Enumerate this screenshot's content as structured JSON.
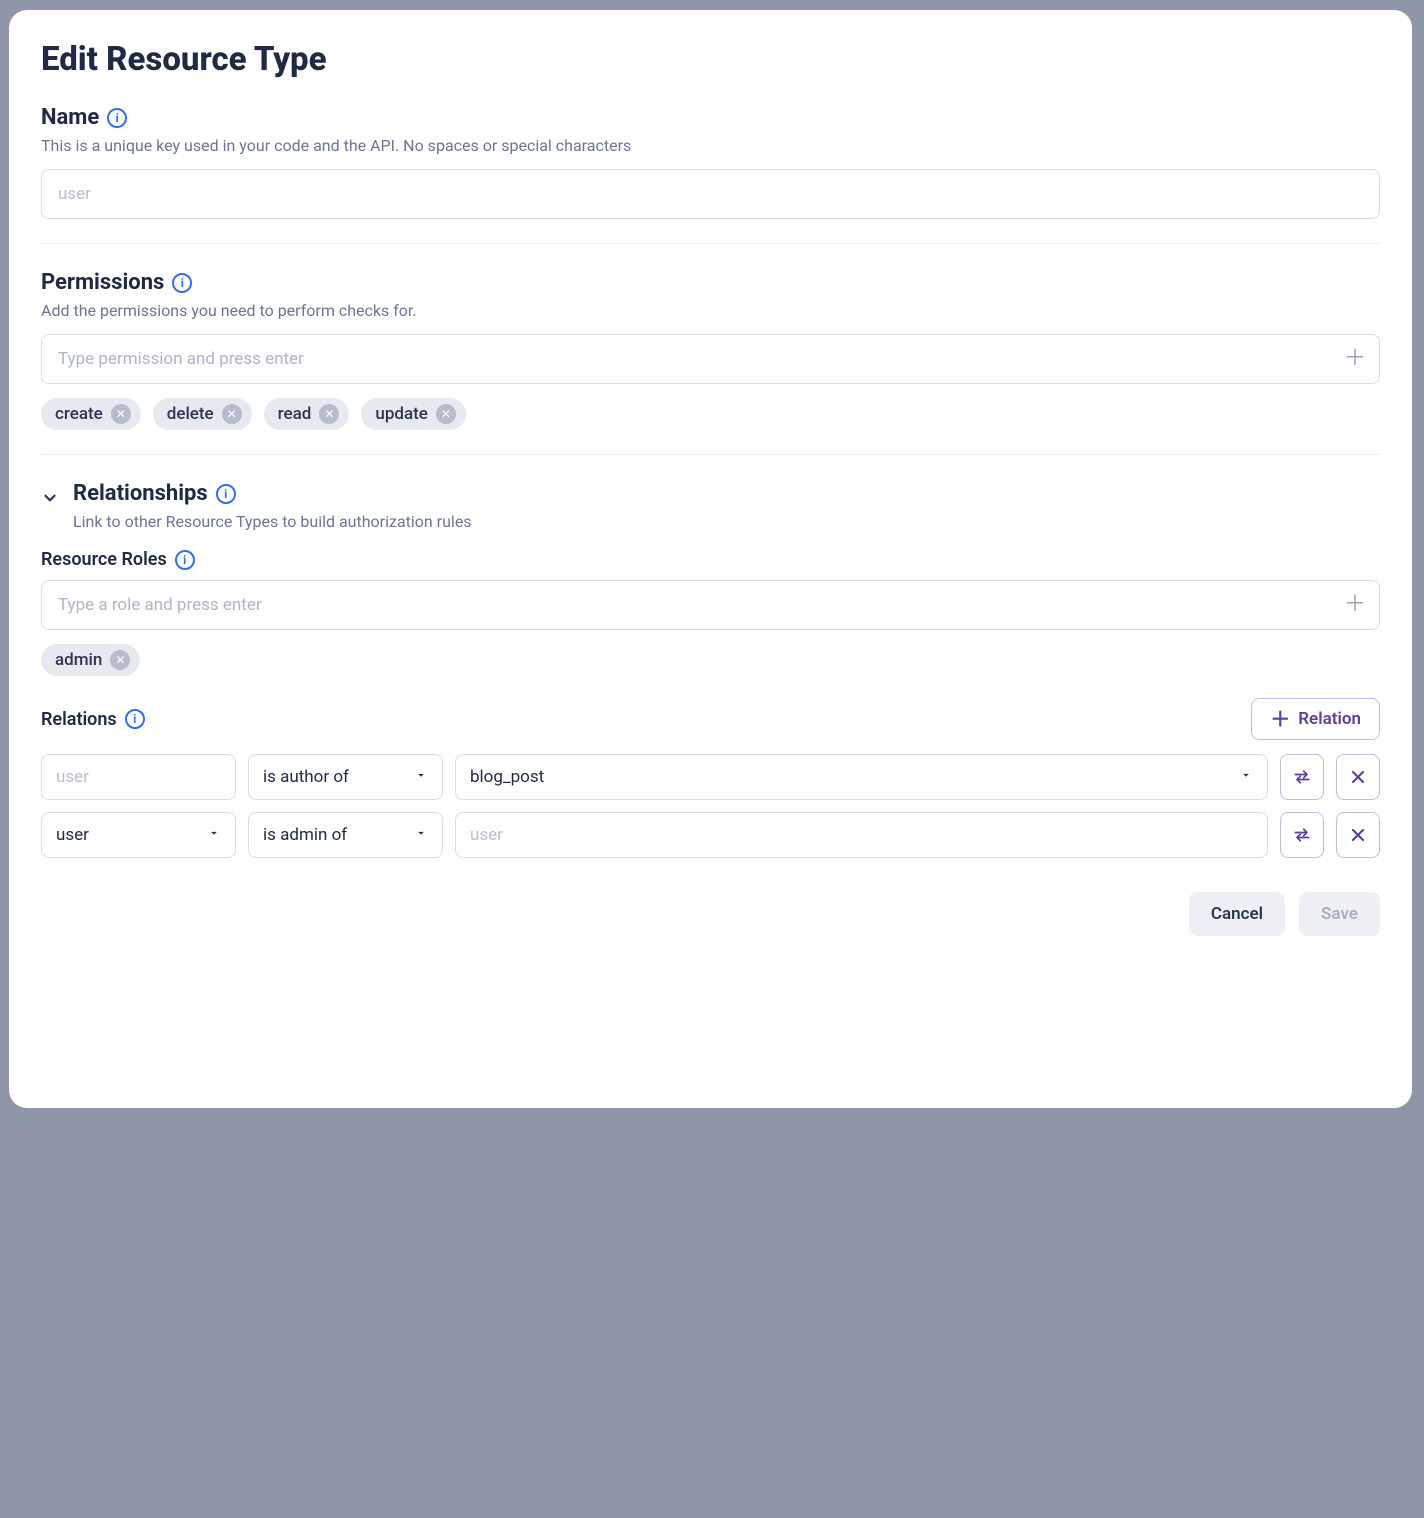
{
  "dialog": {
    "title": "Edit Resource Type"
  },
  "name": {
    "label": "Name",
    "helper": "This is a unique key used in your code and the API. No spaces or special characters",
    "value": "",
    "placeholder": "user"
  },
  "permissions": {
    "label": "Permissions",
    "helper": "Add the permissions you need to perform checks for.",
    "input_placeholder": "Type permission and press enter",
    "chips": [
      "create",
      "delete",
      "read",
      "update"
    ]
  },
  "relationships": {
    "label": "Relationships",
    "helper": "Link to other Resource Types to build authorization rules"
  },
  "resource_roles": {
    "label": "Resource Roles",
    "input_placeholder": "Type a role and press enter",
    "chips": [
      "admin"
    ]
  },
  "relations": {
    "label": "Relations",
    "add_button": "Relation",
    "rows": [
      {
        "subject_value": "",
        "subject_placeholder": "user",
        "subject_dropdown": false,
        "predicate_value": "is author of",
        "object_value": "blog_post",
        "object_placeholder": "",
        "object_dropdown": true
      },
      {
        "subject_value": "user",
        "subject_placeholder": "",
        "subject_dropdown": true,
        "predicate_value": "is admin of",
        "object_value": "",
        "object_placeholder": "user",
        "object_dropdown": false
      }
    ]
  },
  "footer": {
    "cancel": "Cancel",
    "save": "Save"
  }
}
